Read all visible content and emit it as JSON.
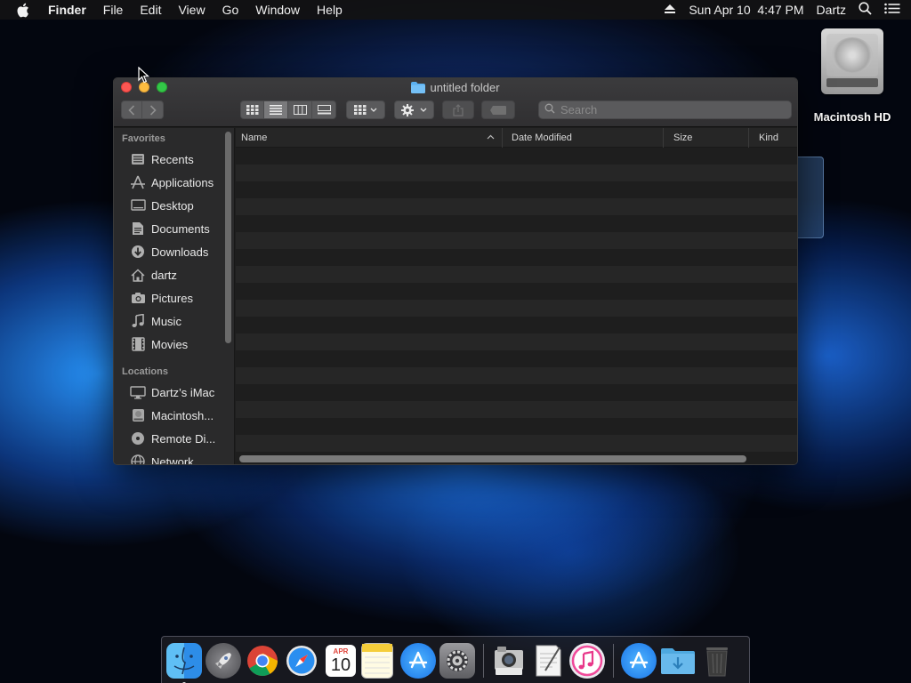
{
  "menubar": {
    "app_name": "Finder",
    "menus": [
      "File",
      "Edit",
      "View",
      "Go",
      "Window",
      "Help"
    ],
    "clock": "Sun Apr 10  4:47 PM",
    "user": "Dartz"
  },
  "desktop": {
    "drive_label": "Macintosh HD"
  },
  "window": {
    "title": "untitled folder",
    "search_placeholder": "Search",
    "sidebar": {
      "favorites_title": "Favorites",
      "favorites": [
        {
          "label": "Recents",
          "icon": "recents-icon"
        },
        {
          "label": "Applications",
          "icon": "applications-icon"
        },
        {
          "label": "Desktop",
          "icon": "desktop-icon"
        },
        {
          "label": "Documents",
          "icon": "documents-icon"
        },
        {
          "label": "Downloads",
          "icon": "downloads-icon"
        },
        {
          "label": "dartz",
          "icon": "home-icon"
        },
        {
          "label": "Pictures",
          "icon": "pictures-icon"
        },
        {
          "label": "Music",
          "icon": "music-icon"
        },
        {
          "label": "Movies",
          "icon": "movies-icon"
        }
      ],
      "locations_title": "Locations",
      "locations": [
        {
          "label": "Dartz’s iMac",
          "icon": "imac-icon"
        },
        {
          "label": "Macintosh...",
          "icon": "drive-icon"
        },
        {
          "label": "Remote Di...",
          "icon": "disc-icon"
        },
        {
          "label": "Network",
          "icon": "network-icon"
        }
      ]
    },
    "columns": {
      "name": "Name",
      "date_modified": "Date Modified",
      "size": "Size",
      "kind": "Kind"
    }
  },
  "dock": {
    "calendar_month": "APR",
    "calendar_day": "10",
    "items": [
      "Finder",
      "Launchpad",
      "Google Chrome",
      "Safari",
      "Calendar",
      "Notes",
      "App Store",
      "System Preferences",
      "Image Capture",
      "TextEdit",
      "iTunes",
      "Applications",
      "Downloads",
      "Trash"
    ]
  }
}
